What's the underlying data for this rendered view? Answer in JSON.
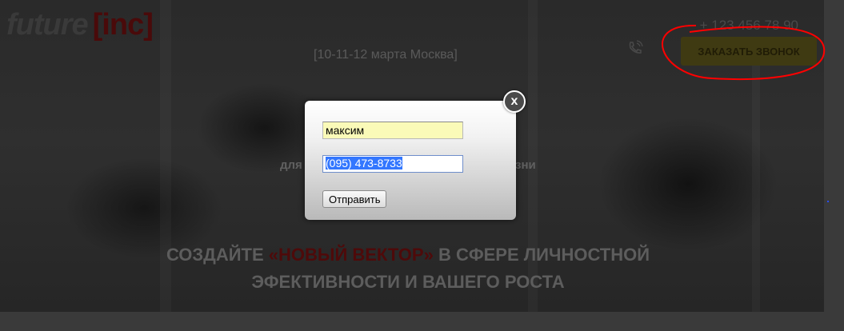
{
  "header": {
    "logo_main": "future",
    "logo_inc": "[inc]",
    "event_date": "[10-11-12 марта Москва]",
    "phone": "+ 123 456 78 90",
    "call_button_label": "ЗАКАЗАТЬ ЗВОНОК"
  },
  "hero": {
    "subtitle_left": "для",
    "subtitle_right": "зни",
    "headline_part1": "СОЗДАЙТЕ ",
    "headline_accent": "«НОВЫЙ ВЕКТОР»",
    "headline_part2": " В СФЕРЕ ЛИЧНОСТНОЙ",
    "headline_line2": "ЭФЕКТИВНОСТИ И ВАШЕГО РОСТА"
  },
  "modal": {
    "close_label": "x",
    "name_value": "максим",
    "phone_value": "(095) 473-8733",
    "submit_label": "Отправить"
  },
  "colors": {
    "annotation": "#ff0000",
    "accent_dark_red": "#4e0a0a",
    "call_button_bg": "#3f3a12"
  },
  "icons": {
    "phone_icon": "phone-icon",
    "close_icon": "close-icon"
  }
}
